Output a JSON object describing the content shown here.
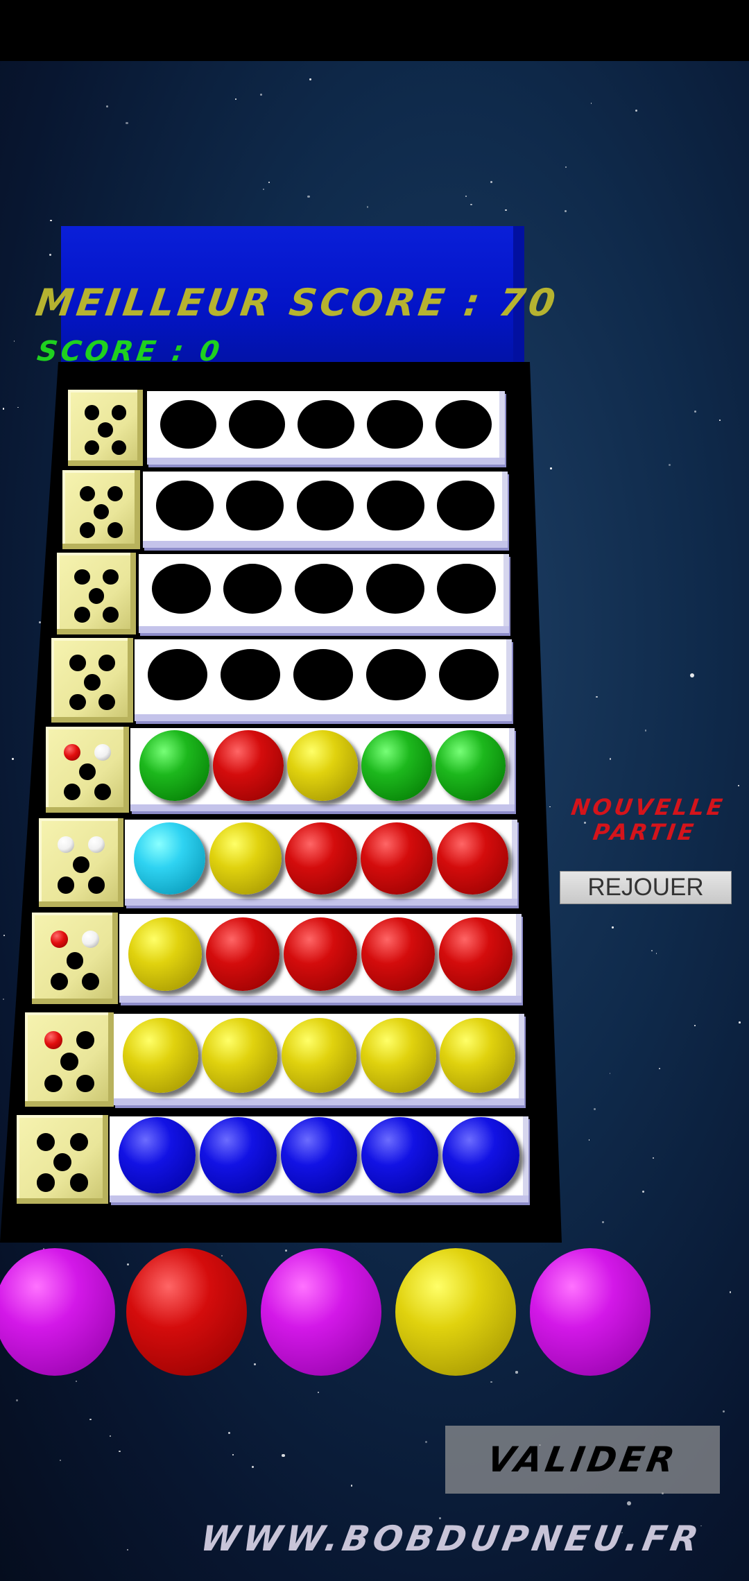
{
  "game": {
    "best_score_label": "MEILLEUR SCORE : 70",
    "score_label": "SCORE : 0",
    "new_game_line1": "NOUVELLE",
    "new_game_line2": "PARTIE",
    "replay_label": "REJOUER",
    "validate_label": "VALIDER",
    "website": "WWW.BOBDUPNEU.FR"
  },
  "colors": {
    "green": "#1db81d",
    "red": "#d40c0c",
    "yellow": "#e0d20e",
    "blue": "#1212e4",
    "cyan": "#2fd3f2",
    "magenta": "#d318e8",
    "hole": "#000000"
  },
  "board": {
    "rows": [
      {
        "balls": [
          "hole",
          "hole",
          "hole",
          "hole",
          "hole"
        ],
        "pegs": []
      },
      {
        "balls": [
          "hole",
          "hole",
          "hole",
          "hole",
          "hole"
        ],
        "pegs": []
      },
      {
        "balls": [
          "hole",
          "hole",
          "hole",
          "hole",
          "hole"
        ],
        "pegs": []
      },
      {
        "balls": [
          "hole",
          "hole",
          "hole",
          "hole",
          "hole"
        ],
        "pegs": []
      },
      {
        "balls": [
          "green",
          "red",
          "yellow",
          "green",
          "green"
        ],
        "pegs": [
          "red",
          "white"
        ]
      },
      {
        "balls": [
          "cyan",
          "yellow",
          "red",
          "red",
          "red"
        ],
        "pegs": [
          "white",
          "white"
        ]
      },
      {
        "balls": [
          "yellow",
          "red",
          "red",
          "red",
          "red"
        ],
        "pegs": [
          "red",
          "white"
        ]
      },
      {
        "balls": [
          "yellow",
          "yellow",
          "yellow",
          "yellow",
          "yellow"
        ],
        "pegs": [
          "red"
        ]
      },
      {
        "balls": [
          "blue",
          "blue",
          "blue",
          "blue",
          "blue"
        ],
        "pegs": []
      }
    ],
    "palette": [
      "magenta",
      "red",
      "magenta",
      "yellow",
      "magenta"
    ]
  }
}
